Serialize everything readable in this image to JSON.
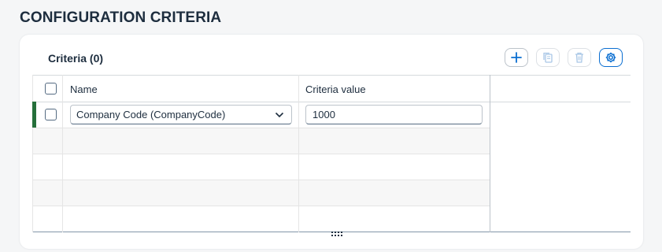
{
  "section": {
    "title": "CONFIGURATION CRITERIA"
  },
  "table_toolbar": {
    "title": "Criteria (0)",
    "buttons": [
      {
        "icon": "add-icon",
        "enabled": true
      },
      {
        "icon": "copy-icon",
        "enabled": false
      },
      {
        "icon": "delete-icon",
        "enabled": false
      },
      {
        "icon": "settings-icon",
        "enabled": true
      }
    ]
  },
  "table": {
    "columns": [
      "Name",
      "Criteria value"
    ],
    "rows": [
      {
        "name": "Company Code (CompanyCode)",
        "value": "1000"
      }
    ],
    "empty_rows": 4
  },
  "colors": {
    "accent": "#0a6ed1",
    "row_highlight": "#256f3a",
    "text": "#1d2d3e"
  }
}
